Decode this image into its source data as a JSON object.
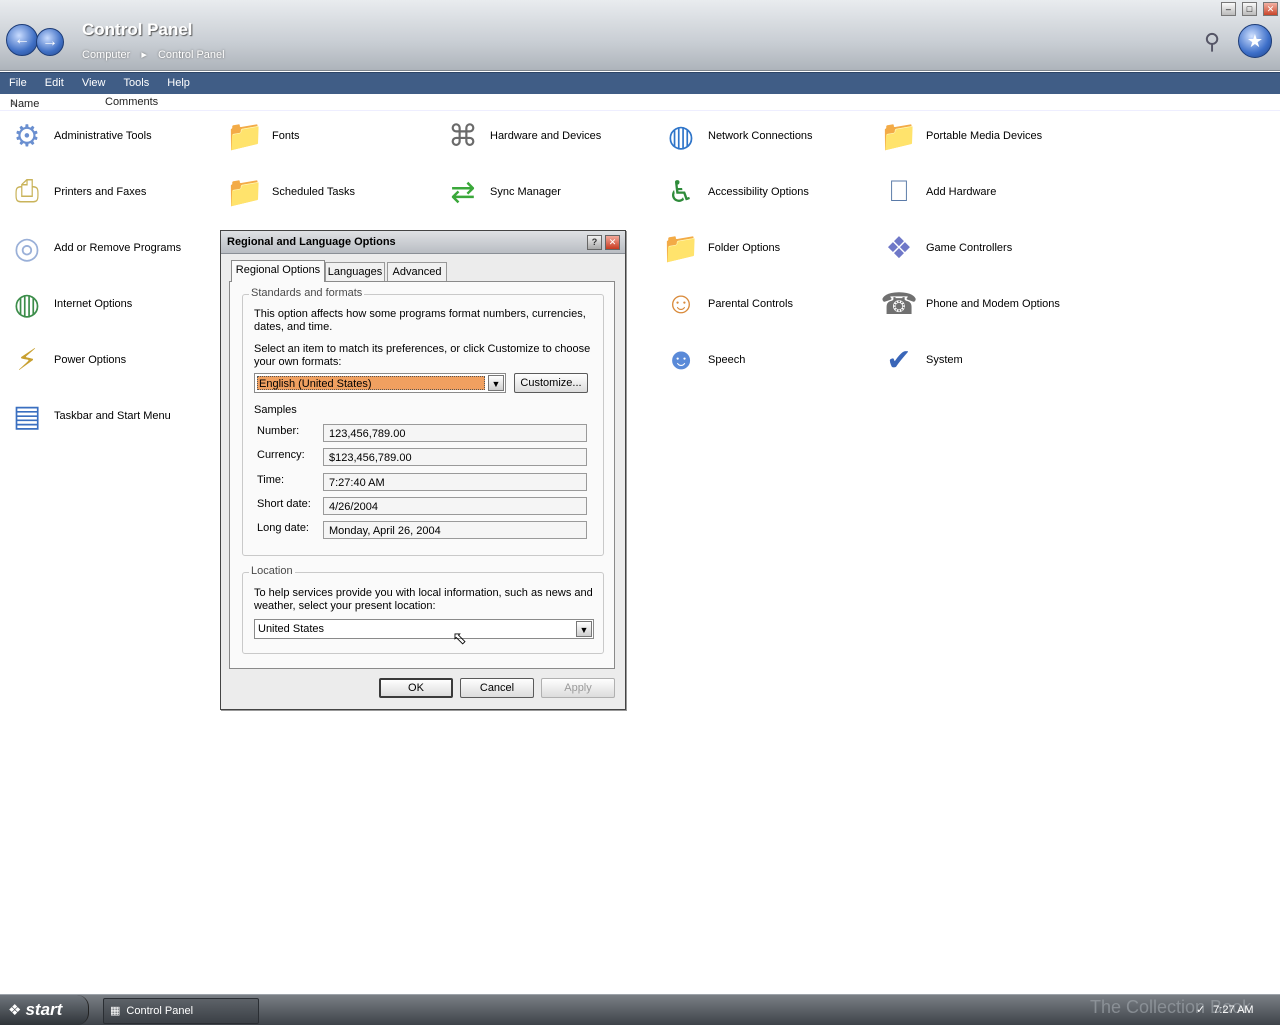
{
  "window": {
    "title": "Control Panel",
    "breadcrumb": [
      "Computer",
      "Control Panel"
    ],
    "controls": {
      "minimize": "–",
      "maximize": "□",
      "close": "✕"
    }
  },
  "menu": [
    "File",
    "Edit",
    "View",
    "Tools",
    "Help"
  ],
  "columns": {
    "name": "Name",
    "comments": "Comments"
  },
  "items": [
    {
      "label": "Administrative Tools",
      "icon": "admin-tools-icon",
      "glyph": "⚙",
      "color": "#6a8fd0"
    },
    {
      "label": "Printers and Faxes",
      "icon": "printer-icon",
      "glyph": "⎙",
      "color": "#c9b35a"
    },
    {
      "label": "Add or Remove Programs",
      "icon": "cd-box-icon",
      "glyph": "◎",
      "color": "#9ab0d8"
    },
    {
      "label": "Internet Options",
      "icon": "globe-icon",
      "glyph": "◍",
      "color": "#3c8d4a"
    },
    {
      "label": "Power Options",
      "icon": "power-plug-icon",
      "glyph": "⚡",
      "color": "#c8a030"
    },
    {
      "label": "Taskbar and Start Menu",
      "icon": "taskbar-icon",
      "glyph": "▤",
      "color": "#3a6fc0"
    },
    {
      "label": "Fonts",
      "icon": "folder-fonts-icon",
      "glyph": "📁",
      "color": "#e6c24a"
    },
    {
      "label": "Scheduled Tasks",
      "icon": "folder-clock-icon",
      "glyph": "📁",
      "color": "#e6c24a"
    },
    {
      "label": "Hardware and Devices",
      "icon": "hardware-icon",
      "glyph": "⌘",
      "color": "#6a6a6a"
    },
    {
      "label": "Sync Manager",
      "icon": "sync-arrows-icon",
      "glyph": "⇄",
      "color": "#3aa83a"
    },
    {
      "label": "Network Connections",
      "icon": "network-globe-icon",
      "glyph": "◍",
      "color": "#2f75c9"
    },
    {
      "label": "Accessibility Options",
      "icon": "wheelchair-icon",
      "glyph": "♿",
      "color": "#2e8b3a"
    },
    {
      "label": "Folder Options",
      "icon": "folder-check-icon",
      "glyph": "📁",
      "color": "#e6c24a"
    },
    {
      "label": "Parental Controls",
      "icon": "people-icon",
      "glyph": "☺",
      "color": "#d98a3a"
    },
    {
      "label": "Speech",
      "icon": "speech-bubble-icon",
      "glyph": "☻",
      "color": "#5a8ad8"
    },
    {
      "label": "Portable Media Devices",
      "icon": "media-folder-icon",
      "glyph": "📁",
      "color": "#e6c24a"
    },
    {
      "label": "Add Hardware",
      "icon": "add-hardware-icon",
      "glyph": "⎕",
      "color": "#5a7aa8"
    },
    {
      "label": "Game Controllers",
      "icon": "gamepad-icon",
      "glyph": "❖",
      "color": "#6f78c8"
    },
    {
      "label": "Phone and Modem Options",
      "icon": "phone-modem-icon",
      "glyph": "☎",
      "color": "#707070"
    },
    {
      "label": "System",
      "icon": "system-monitor-icon",
      "glyph": "✔",
      "color": "#3a66b8"
    }
  ],
  "dialog": {
    "title": "Regional and Language Options",
    "help": "?",
    "close": "✕",
    "tabs": [
      "Regional Options",
      "Languages",
      "Advanced"
    ],
    "standards": {
      "title": "Standards and formats",
      "description": "This option affects how some programs format numbers, currencies, dates, and time.",
      "instruction": "Select an item to match its preferences, or click Customize to choose your own formats:",
      "selected": "English (United States)",
      "customize": "Customize...",
      "samples_title": "Samples",
      "samples": [
        {
          "label": "Number:",
          "value": "123,456,789.00"
        },
        {
          "label": "Currency:",
          "value": "$123,456,789.00"
        },
        {
          "label": "Time:",
          "value": "7:27:40 AM"
        },
        {
          "label": "Short date:",
          "value": "4/26/2004"
        },
        {
          "label": "Long date:",
          "value": "Monday, April 26, 2004"
        }
      ]
    },
    "location": {
      "title": "Location",
      "description": "To help services provide you with local information, such as news and weather, select your present location:",
      "selected": "United States"
    },
    "buttons": {
      "ok": "OK",
      "cancel": "Cancel",
      "apply": "Apply"
    }
  },
  "taskbar": {
    "start": "start",
    "task": "Control Panel",
    "clock": "7:27 AM",
    "watermark": "The Collection Book"
  },
  "colors": {
    "menubar": "#405d86",
    "selection": "#f0a060"
  }
}
